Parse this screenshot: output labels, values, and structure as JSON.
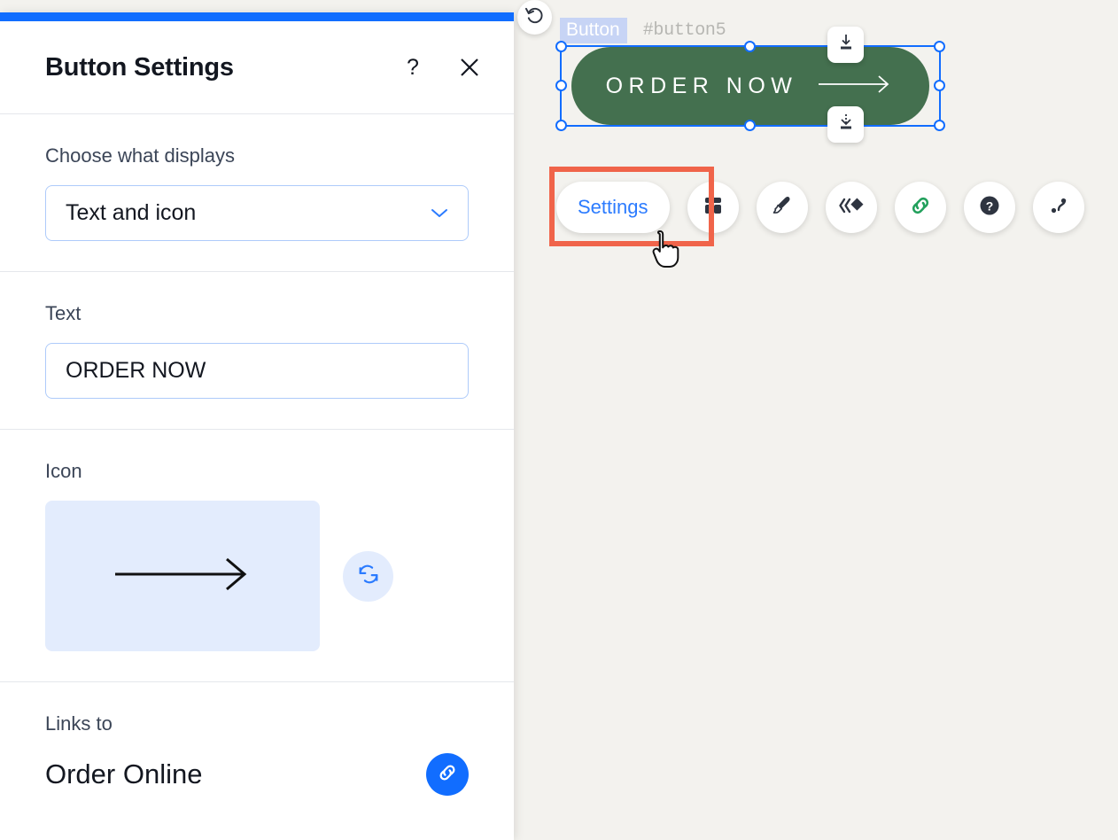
{
  "panel": {
    "title": "Button Settings",
    "help_icon": "question-mark-icon",
    "close_icon": "close-icon",
    "sections": {
      "display": {
        "label": "Choose what displays",
        "value": "Text and icon",
        "chevron_icon": "chevron-down-icon"
      },
      "text": {
        "label": "Text",
        "value": "ORDER NOW"
      },
      "icon": {
        "label": "Icon",
        "preview_icon": "long-right-arrow-icon",
        "replace_icon": "refresh-replace-icon"
      },
      "links": {
        "label": "Links to",
        "value": "Order Online",
        "edit_icon": "link-icon"
      }
    }
  },
  "canvas": {
    "undo_icon": "undo-rotate-left-icon",
    "selection": {
      "type_chip": "Button",
      "element_id": "#button5"
    },
    "element": {
      "label": "ORDER NOW",
      "arrow_icon": "long-right-arrow-icon",
      "fill_color": "#44704f",
      "text_color": "#ffffff"
    },
    "float_buttons": [
      {
        "name": "dock-top-icon",
        "icon": "arrow-down-to-line-icon"
      },
      {
        "name": "dock-bottom-icon",
        "icon": "dashed-arrow-down-to-line-icon"
      }
    ]
  },
  "toolbar": {
    "highlight_color": "#f0644a",
    "accent_color": "#2b7bff",
    "items": [
      {
        "name": "settings",
        "label": "Settings",
        "kind": "text",
        "icon": null
      },
      {
        "name": "layout",
        "label": "",
        "kind": "icon",
        "icon": "layout-panel-icon"
      },
      {
        "name": "design",
        "label": "",
        "kind": "icon",
        "icon": "paintbrush-icon"
      },
      {
        "name": "animation",
        "label": "",
        "kind": "icon",
        "icon": "motion-effect-icon"
      },
      {
        "name": "link",
        "label": "",
        "kind": "icon",
        "icon": "link-chain-icon"
      },
      {
        "name": "help",
        "label": "",
        "kind": "icon",
        "icon": "help-circle-icon"
      },
      {
        "name": "connect",
        "label": "",
        "kind": "icon",
        "icon": "connect-data-icon"
      }
    ]
  },
  "colors": {
    "brand_blue": "#116dff",
    "canvas_bg": "#f3f2ee",
    "button_green": "#44704f",
    "highlight_red": "#f0644a"
  }
}
